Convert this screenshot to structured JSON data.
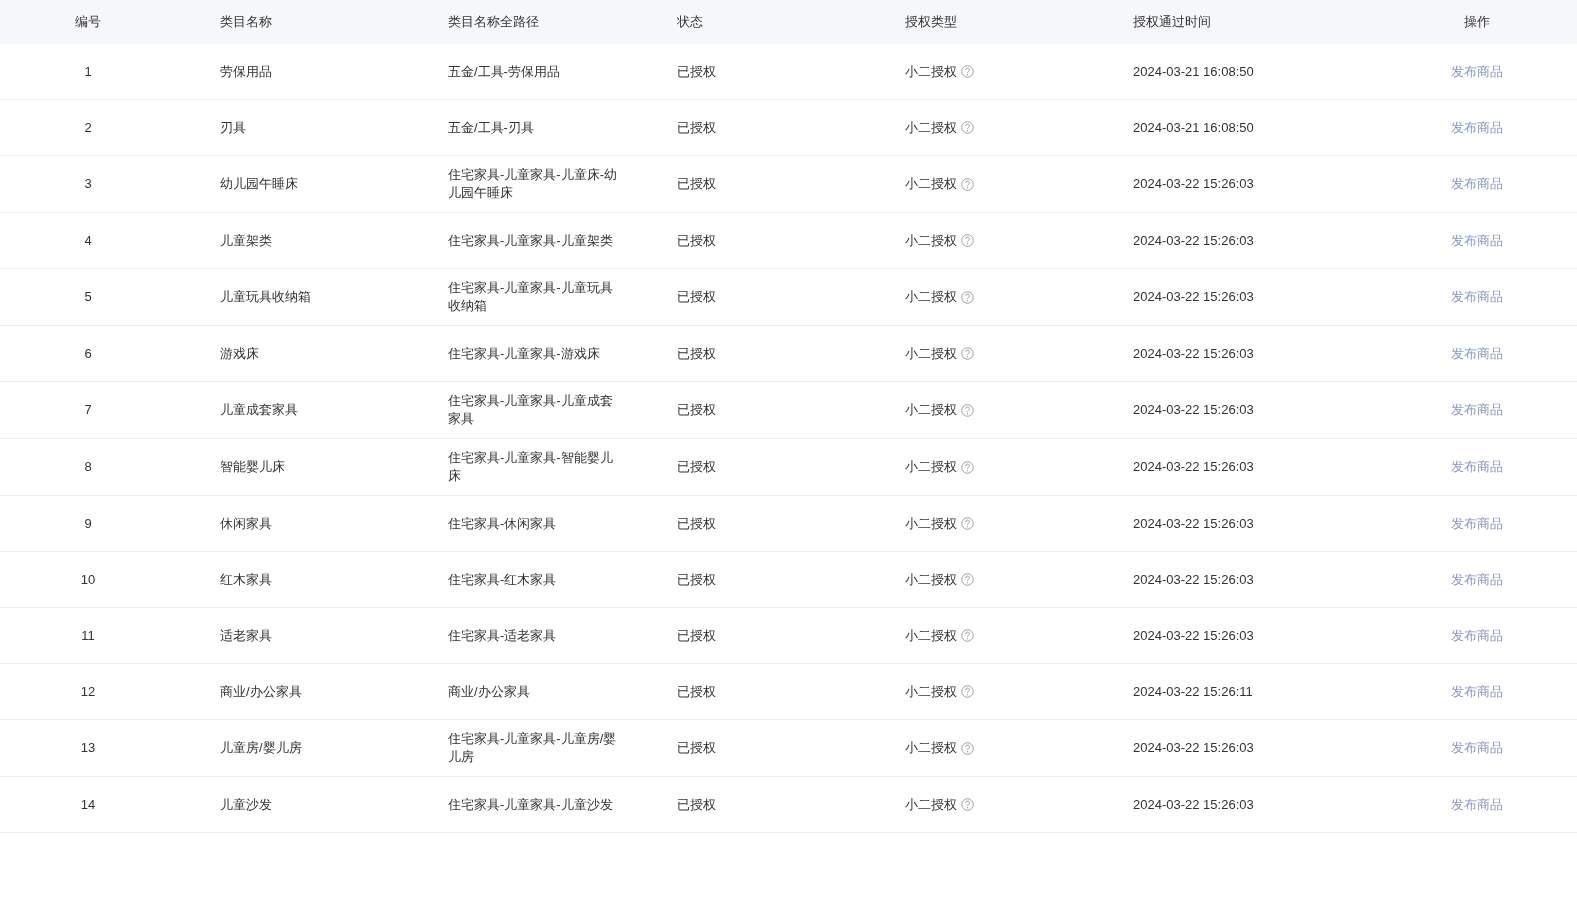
{
  "table": {
    "columns": [
      "编号",
      "类目名称",
      "类目名称全路径",
      "状态",
      "授权类型",
      "授权通过时间",
      "操作"
    ],
    "rows": [
      {
        "id": "1",
        "name": "劳保用品",
        "path": "五金/工具-劳保用品",
        "status": "已授权",
        "auth_type": "小二授权",
        "time": "2024-03-21 16:08:50",
        "action": "发布商品"
      },
      {
        "id": "2",
        "name": "刃具",
        "path": "五金/工具-刃具",
        "status": "已授权",
        "auth_type": "小二授权",
        "time": "2024-03-21 16:08:50",
        "action": "发布商品"
      },
      {
        "id": "3",
        "name": "幼儿园午睡床",
        "path": "住宅家具-儿童家具-儿童床-幼儿园午睡床",
        "status": "已授权",
        "auth_type": "小二授权",
        "time": "2024-03-22 15:26:03",
        "action": "发布商品"
      },
      {
        "id": "4",
        "name": "儿童架类",
        "path": "住宅家具-儿童家具-儿童架类",
        "status": "已授权",
        "auth_type": "小二授权",
        "time": "2024-03-22 15:26:03",
        "action": "发布商品"
      },
      {
        "id": "5",
        "name": "儿童玩具收纳箱",
        "path": "住宅家具-儿童家具-儿童玩具收纳箱",
        "status": "已授权",
        "auth_type": "小二授权",
        "time": "2024-03-22 15:26:03",
        "action": "发布商品"
      },
      {
        "id": "6",
        "name": "游戏床",
        "path": "住宅家具-儿童家具-游戏床",
        "status": "已授权",
        "auth_type": "小二授权",
        "time": "2024-03-22 15:26:03",
        "action": "发布商品"
      },
      {
        "id": "7",
        "name": "儿童成套家具",
        "path": "住宅家具-儿童家具-儿童成套家具",
        "status": "已授权",
        "auth_type": "小二授权",
        "time": "2024-03-22 15:26:03",
        "action": "发布商品"
      },
      {
        "id": "8",
        "name": "智能婴儿床",
        "path": "住宅家具-儿童家具-智能婴儿床",
        "status": "已授权",
        "auth_type": "小二授权",
        "time": "2024-03-22 15:26:03",
        "action": "发布商品"
      },
      {
        "id": "9",
        "name": "休闲家具",
        "path": "住宅家具-休闲家具",
        "status": "已授权",
        "auth_type": "小二授权",
        "time": "2024-03-22 15:26:03",
        "action": "发布商品"
      },
      {
        "id": "10",
        "name": "红木家具",
        "path": "住宅家具-红木家具",
        "status": "已授权",
        "auth_type": "小二授权",
        "time": "2024-03-22 15:26:03",
        "action": "发布商品"
      },
      {
        "id": "11",
        "name": "适老家具",
        "path": "住宅家具-适老家具",
        "status": "已授权",
        "auth_type": "小二授权",
        "time": "2024-03-22 15:26:03",
        "action": "发布商品"
      },
      {
        "id": "12",
        "name": "商业/办公家具",
        "path": "商业/办公家具",
        "status": "已授权",
        "auth_type": "小二授权",
        "time": "2024-03-22 15:26:11",
        "action": "发布商品"
      },
      {
        "id": "13",
        "name": "儿童房/婴儿房",
        "path": "住宅家具-儿童家具-儿童房/婴儿房",
        "status": "已授权",
        "auth_type": "小二授权",
        "time": "2024-03-22 15:26:03",
        "action": "发布商品"
      },
      {
        "id": "14",
        "name": "儿童沙发",
        "path": "住宅家具-儿童家具-儿童沙发",
        "status": "已授权",
        "auth_type": "小二授权",
        "time": "2024-03-22 15:26:03",
        "action": "发布商品"
      }
    ]
  }
}
